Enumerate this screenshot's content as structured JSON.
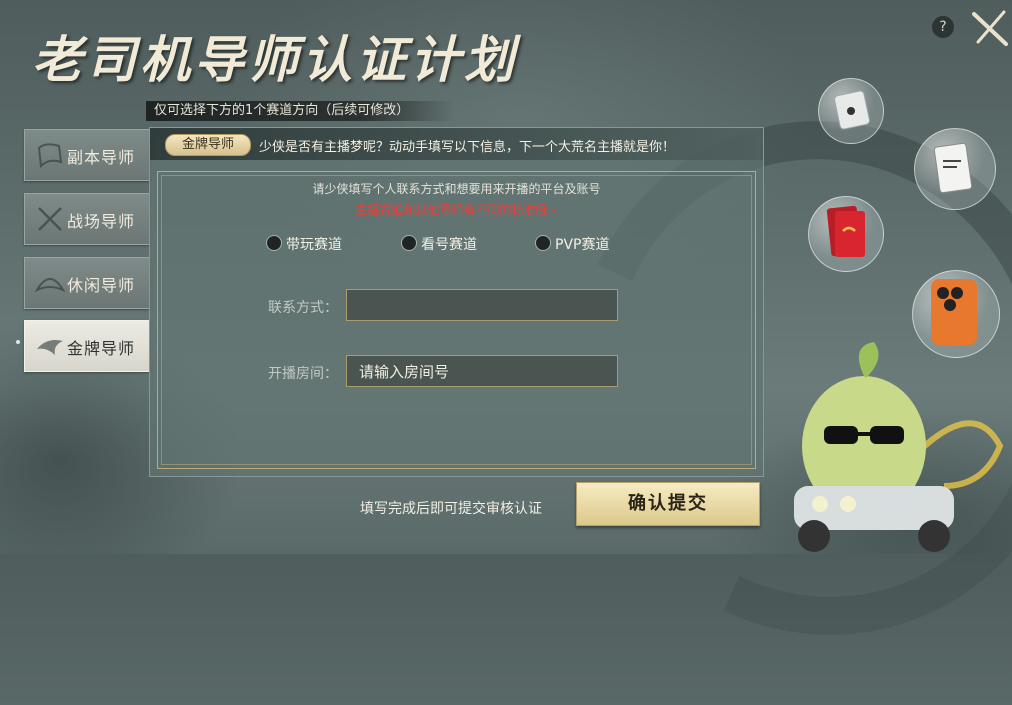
{
  "title": "老司机导师认证计划",
  "hint": "仅可选择下方的1个赛道方向（后续可修改）",
  "tabs": [
    {
      "label": "副本导师"
    },
    {
      "label": "战场导师"
    },
    {
      "label": "休闲导师"
    },
    {
      "label": "金牌导师"
    }
  ],
  "panel": {
    "tag": "金牌导师",
    "header_text": "少侠是否有主播梦呢？动动手填写以下信息，下一个大荒名主播就是你！",
    "info_line1": "请少侠填写个人联系方式和想要用来开播的平台及账号",
    "info_line2": "主播赛道和其他导师有不同的标准哦~",
    "options": [
      {
        "label": "带玩赛道"
      },
      {
        "label": "看号赛道"
      },
      {
        "label": "PVP赛道"
      }
    ],
    "contact_label": "联系方式：",
    "contact_value": "",
    "room_label": "开播房间：",
    "room_placeholder": "请输入房间号"
  },
  "footer": {
    "note": "填写完成后即可提交审核认证",
    "submit": "确认提交"
  },
  "colors": {
    "accent_gold": "#dcc88a",
    "warning_red": "#e8403a"
  }
}
